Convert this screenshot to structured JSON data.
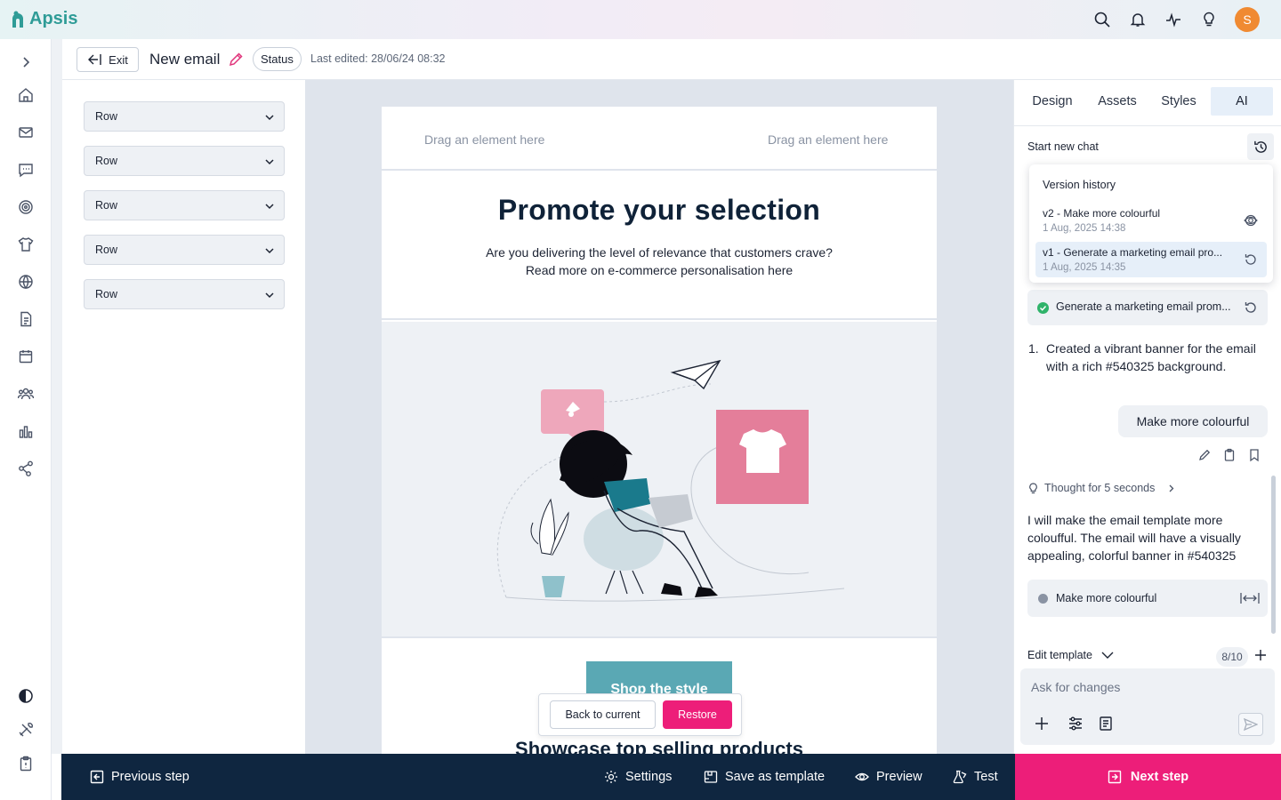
{
  "app": {
    "brand": "Apsis"
  },
  "topbar": {
    "avatar_initial": "S",
    "icons": [
      "search-icon",
      "bell-icon",
      "activity-icon",
      "lightbulb-icon"
    ]
  },
  "rail": {
    "icons": [
      "chevron-right-icon",
      "home-icon",
      "mail-icon",
      "chat-icon",
      "target-icon",
      "tshirt-icon",
      "globe-icon",
      "document-icon",
      "calendar-icon",
      "audience-icon",
      "bar-chart-icon",
      "share-icon",
      "contrast-icon",
      "tools-icon",
      "clipboard-icon"
    ]
  },
  "header": {
    "exit_label": "Exit",
    "title": "New email",
    "status_label": "Status",
    "last_edited": "Last edited: 28/06/24 08:32"
  },
  "rows_panel": {
    "items": [
      "Row",
      "Row",
      "Row",
      "Row",
      "Row"
    ]
  },
  "canvas": {
    "drop_left": "Drag an element here",
    "drop_right": "Drag an element here",
    "hero_title": "Promote your selection",
    "hero_line1": "Are you delivering the level of relevance that customers crave?",
    "hero_line2": "Read more on e-commerce personalisation here",
    "cta_label": "Shop the style",
    "showcase_title": "Showcase top selling products",
    "restore_bar": {
      "back_label": "Back to current",
      "restore_label": "Restore"
    },
    "colors": {
      "accent_pink": "#ed1e79",
      "teal": "#5aa8b4",
      "tile_pink": "#e47e9a"
    }
  },
  "right_panel": {
    "tabs": [
      "Design",
      "Assets",
      "Styles",
      "AI"
    ],
    "active_tab": "AI",
    "start_new_chat": "Start new chat",
    "version_history": {
      "title": "Version history",
      "items": [
        {
          "name": "v2 - Make more colourful",
          "date": "1 Aug, 2025 14:38"
        },
        {
          "name": "v1 - Generate a marketing email pro...",
          "date": "1 Aug, 2025 14:35"
        }
      ]
    },
    "generated_chip": "Generate a marketing email prom...",
    "ai_list": {
      "number": "1.",
      "text": "Created a vibrant banner for the email with a rich #540325 background."
    },
    "user_message": "Make more colourful",
    "thought": "Thought for 5 seconds",
    "ai_paragraph": "I will make the email template more coloufful. The email will have a visually appealing, colorful banner in #540325",
    "status_chip": "Make more colourful",
    "edit_template_label": "Edit template",
    "counter": "8/10",
    "prompt_placeholder": "Ask for changes"
  },
  "footer": {
    "previous_step": "Previous step",
    "settings": "Settings",
    "save_as_template": "Save as template",
    "preview": "Preview",
    "test": "Test",
    "next_step": "Next step"
  }
}
